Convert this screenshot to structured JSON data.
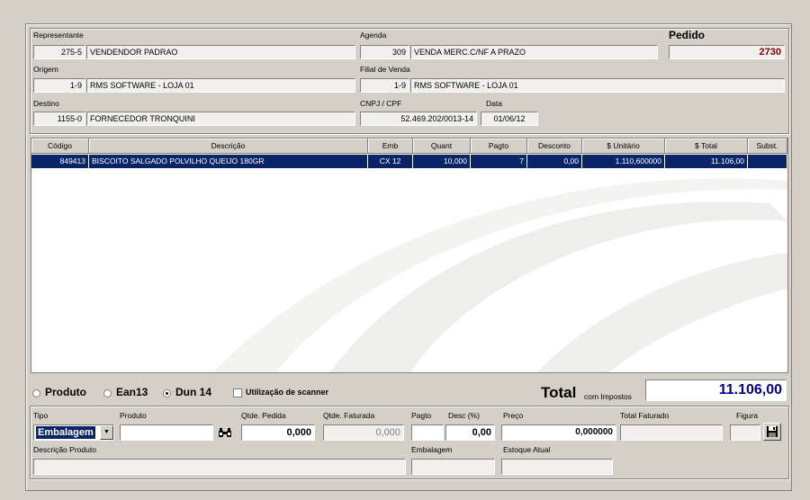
{
  "header": {
    "representante": {
      "label": "Representante",
      "code": "275-5",
      "name": "VENDENDOR PADRAO"
    },
    "agenda": {
      "label": "Agenda",
      "code": "309",
      "name": "VENDA MERC.C/NF A PRAZO"
    },
    "pedido": {
      "label": "Pedido",
      "number": "2730"
    },
    "origem": {
      "label": "Origem",
      "code": "1-9",
      "name": "RMS SOFTWARE - LOJA 01"
    },
    "filial": {
      "label": "Filial de Venda",
      "code": "1-9",
      "name": "RMS SOFTWARE - LOJA 01"
    },
    "destino": {
      "label": "Destino",
      "code": "1155-0",
      "name": "FORNECEDOR TRONQUINI"
    },
    "cnpj": {
      "label": "CNPJ / CPF",
      "value": "52.469.202/0013-14"
    },
    "data": {
      "label": "Data",
      "value": "01/06/12"
    }
  },
  "grid": {
    "columns": [
      "Código",
      "Descrição",
      "Emb",
      "Quant",
      "Pagto",
      "Desconto",
      "$ Unitário",
      "$ Total",
      "Subst."
    ],
    "rows": [
      {
        "codigo": "849413",
        "descricao": "BISCOITO SALGADO POLVILHO QUEIJO 180GR",
        "emb": "CX  12",
        "quant": "10,000",
        "pagto": "7",
        "desconto": "0,00",
        "unitario": "1.110,600000",
        "total": "11.106,00",
        "subst": ""
      }
    ]
  },
  "search_mode": {
    "options": [
      "Produto",
      "Ean13",
      "Dun 14"
    ],
    "selected": "Dun 14",
    "scanner_label": "Utilização de scanner"
  },
  "total": {
    "label": "Total",
    "sublabel": "com Impostos",
    "value": "11.106,00"
  },
  "entry": {
    "tipo_label": "Tipo",
    "tipo_value": "Embalagem",
    "produto_label": "Produto",
    "produto_value": "",
    "qtde_pedida_label": "Qtde. Pedida",
    "qtde_pedida_value": "0,000",
    "qtde_faturada_label": "Qtde. Faturada",
    "qtde_faturada_value": "0,000",
    "pagto_label": "Pagto",
    "pagto_value": "",
    "desc_label": "Desc (%)",
    "desc_value": "0,00",
    "preco_label": "Preço",
    "preco_value": "0,000000",
    "total_faturado_label": "Total Faturado",
    "total_faturado_value": "",
    "figura_label": "Figura",
    "descricao_label": "Descrição Produto",
    "descricao_value": "",
    "embalagem_label": "Embalagem",
    "embalagem_value": "",
    "estoque_label": "Estoque Atual",
    "estoque_value": ""
  },
  "colors": {
    "selection": "#0a246a",
    "pedido": "#800000",
    "total": "#000080"
  }
}
